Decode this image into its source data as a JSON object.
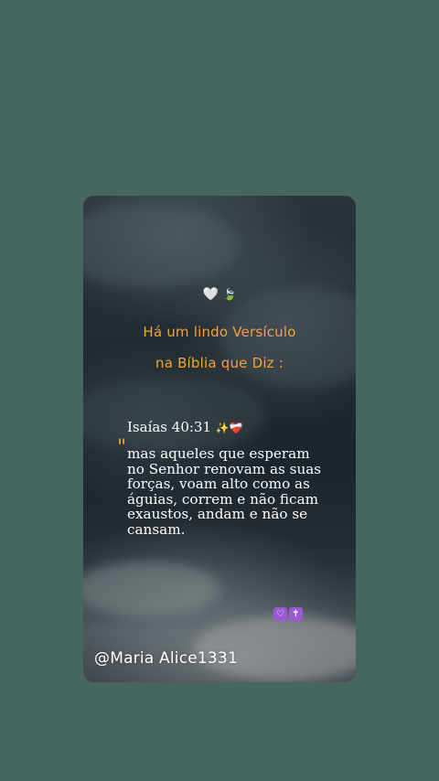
{
  "card": {
    "top_emojis": {
      "white_heart": "🤍",
      "leaf": "🍃"
    },
    "heading_line1": "Há um lindo Versículo",
    "heading_line2": "na Bíblia que Diz :",
    "reference": "Isaías 40:31",
    "reference_emojis": {
      "sparkles": "✨",
      "heart": "❤️‍🩹"
    },
    "quote_mark": "\"",
    "verse": "mas aqueles que esperam no Senhor renovam as suas forças, voam alto como as águias, correm e não ficam exaustos, andam e não se cansam.",
    "bottom_emojis": {
      "heart_box": "♡",
      "cross_box": "✝"
    },
    "handle": "@Maria Alice1331"
  },
  "colors": {
    "page_background": "#466660",
    "heading": "#f2a33a",
    "text": "#ffffff",
    "emoji_box": "#9b59d0"
  }
}
